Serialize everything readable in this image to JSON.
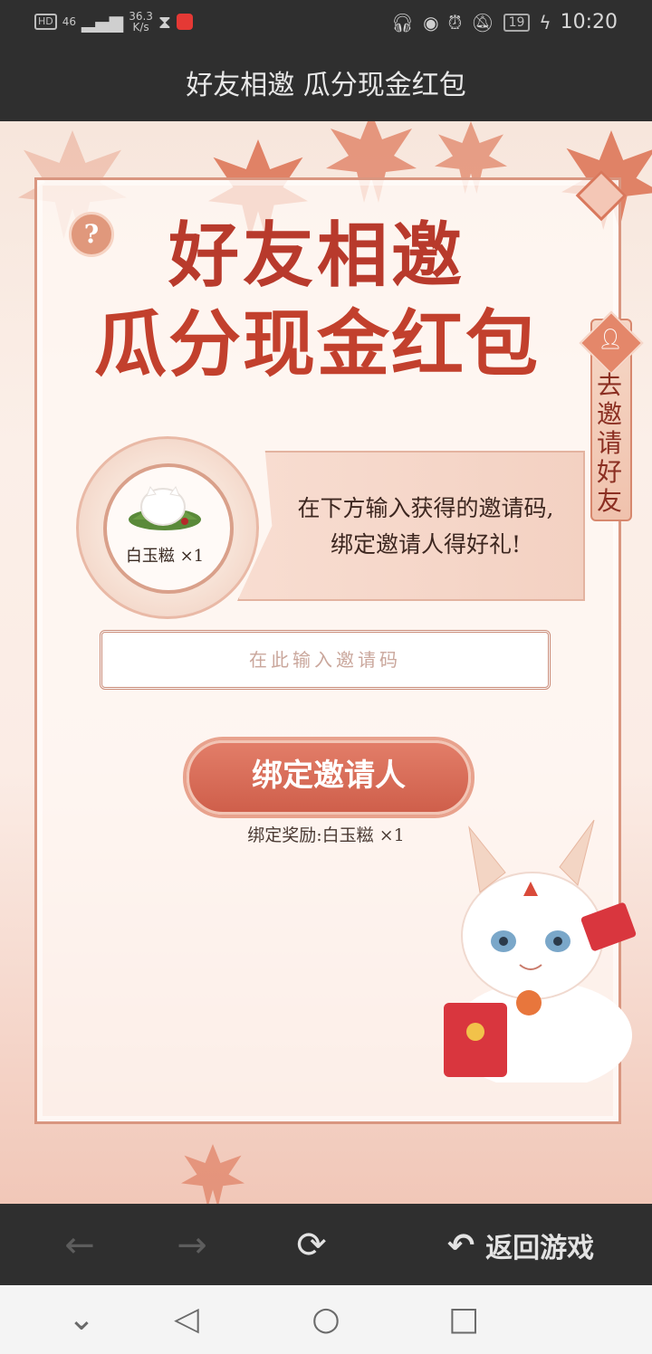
{
  "status_bar": {
    "hd": "HD",
    "signal": "46",
    "speed_value": "36.3",
    "speed_unit": "K/s",
    "battery": "19",
    "time": "10:20"
  },
  "title_bar": {
    "title": "好友相邀 瓜分现金红包"
  },
  "hero": {
    "line1": "好友相邀",
    "line2": "瓜分现金红包"
  },
  "invite_tab": {
    "label": "去邀请好友"
  },
  "reward": {
    "item_caption": "白玉糍 ×1",
    "text_line1": "在下方输入获得的邀请码,",
    "text_line2": "绑定邀请人得好礼!"
  },
  "code_input": {
    "placeholder": "在此输入邀请码",
    "value": ""
  },
  "bind": {
    "button_label": "绑定邀请人",
    "reward_text": "绑定奖励:白玉糍 ×1"
  },
  "browser_nav": {
    "back_to_game_label": "返回游戏"
  },
  "colors": {
    "accent": "#d9604a",
    "panel_border": "#d99680",
    "dark_bar": "#2f2f2f"
  }
}
